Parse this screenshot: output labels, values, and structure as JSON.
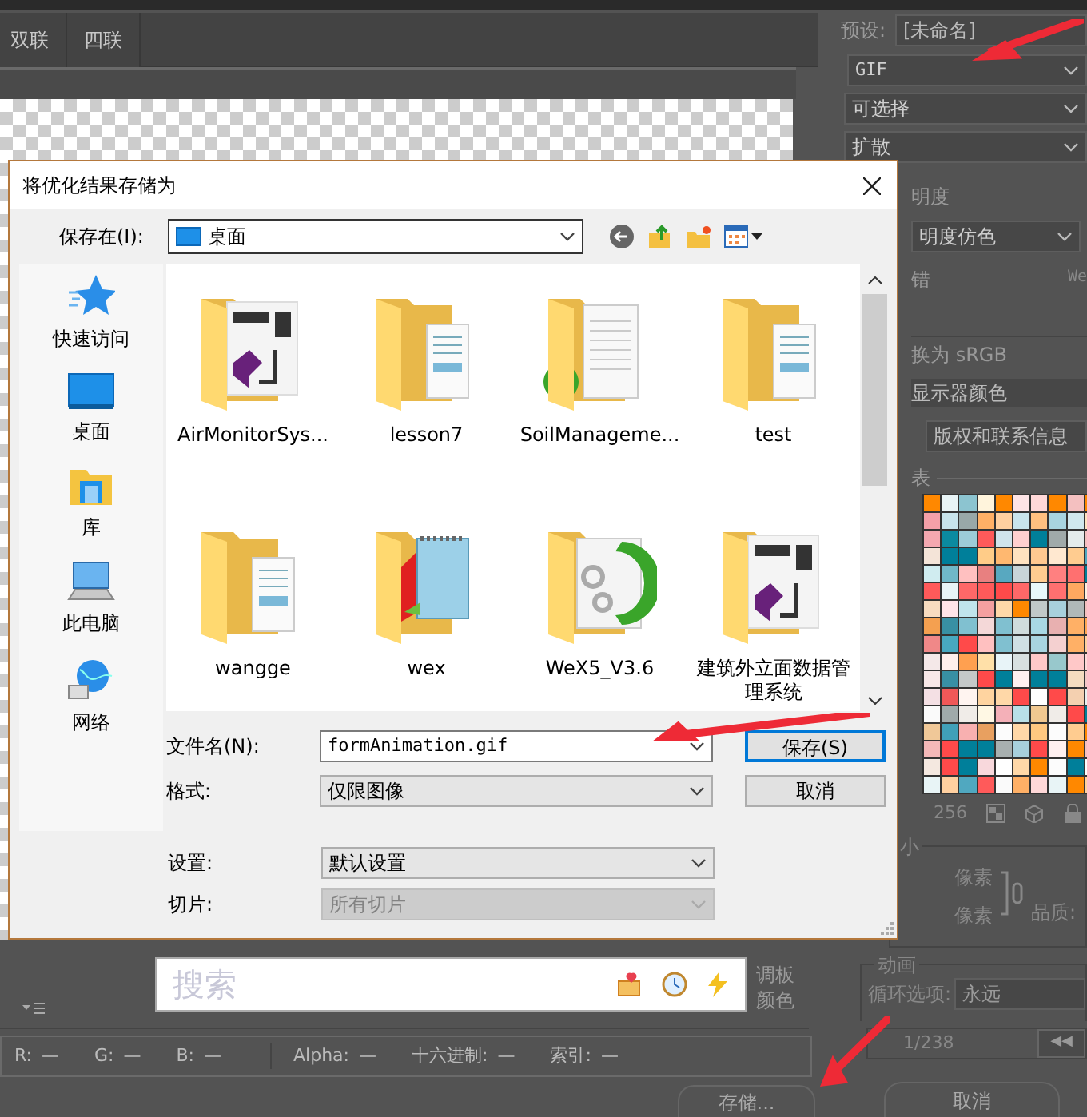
{
  "tabs": [
    {
      "label": "双联",
      "selected": false
    },
    {
      "label": "四联",
      "selected": false
    }
  ],
  "settings": {
    "preset_label": "预设:",
    "preset_value": "[未命名]",
    "format": "GIF",
    "palette_mode": "可选择",
    "dither_mode": "扩散",
    "transparency_label": "明度",
    "transparency_dither": "明度仿色",
    "matte_label": "错",
    "web_snap_label": "We",
    "convert_label": "换为 sRGB",
    "preview": "显示器颜色",
    "metadata": "版权和联系信息",
    "color_table_label": "表",
    "color_count": "256"
  },
  "swatches": [
    {
      "color": "#ff8800"
    },
    {
      "color": "#e8f4f6"
    },
    {
      "color": "#8cc4d0"
    },
    {
      "color": "#fff4dc"
    },
    {
      "color": "#ff8800"
    },
    {
      "color": "#fde4e6"
    },
    {
      "color": "#ffd8d8"
    },
    {
      "color": "#ff8800"
    },
    {
      "color": "#f4c0c0"
    },
    {
      "color": "#ff8800"
    },
    {
      "color": "#f4a0a8"
    },
    {
      "color": "#c8e4ec"
    },
    {
      "color": "#98a8a8"
    },
    {
      "color": "#ffb066"
    },
    {
      "color": "#ffd0a0"
    },
    {
      "color": "#c8e4ec"
    },
    {
      "color": "#ffc080"
    },
    {
      "color": "#a8d4e0"
    },
    {
      "color": "#d0e8ee"
    },
    {
      "color": "#ffe2c0"
    },
    {
      "color": "#f4a8b0"
    },
    {
      "color": "#0b8aa0"
    },
    {
      "color": "#9cccd8"
    },
    {
      "color": "#ff5a5a"
    },
    {
      "color": "#d0e4ec"
    },
    {
      "color": "#ffd0d0"
    },
    {
      "color": "#007f9a"
    },
    {
      "color": "#a0aaaa"
    },
    {
      "color": "#e4ecec"
    },
    {
      "color": "#f4c0c0"
    },
    {
      "color": "#f4e4d8"
    },
    {
      "color": "#007f9a"
    },
    {
      "color": "#007f9a"
    },
    {
      "color": "#ffcc88"
    },
    {
      "color": "#ffb870"
    },
    {
      "color": "#ffe2c0"
    },
    {
      "color": "#ffc890"
    },
    {
      "color": "#ffe8d0"
    },
    {
      "color": "#ffcc90"
    },
    {
      "color": "#50a8c0"
    },
    {
      "color": "#d0ecf0"
    },
    {
      "color": "#70b8c8"
    },
    {
      "color": "#ffc0c0"
    },
    {
      "color": "#e88080"
    },
    {
      "color": "#58a8c0"
    },
    {
      "color": "#c8d4d8"
    },
    {
      "color": "#ffcc90"
    },
    {
      "color": "#ff8080"
    },
    {
      "color": "#ff7070"
    },
    {
      "color": "#007f9a"
    },
    {
      "color": "#ff5a5a"
    },
    {
      "color": "#e8f4f6"
    },
    {
      "color": "#ff6868"
    },
    {
      "color": "#ff5a5a"
    },
    {
      "color": "#ff4a4a"
    },
    {
      "color": "#ff6868"
    },
    {
      "color": "#e8f8fa"
    },
    {
      "color": "#ff7070"
    },
    {
      "color": "#ffa860"
    },
    {
      "color": "#fff0e0"
    },
    {
      "color": "#f8dcc0"
    },
    {
      "color": "#ffe4e8"
    },
    {
      "color": "#c0e4ec"
    },
    {
      "color": "#f4a0a0"
    },
    {
      "color": "#ffd8a8"
    },
    {
      "color": "#ff8800"
    },
    {
      "color": "#c0c8c8"
    },
    {
      "color": "#a8d0dc"
    },
    {
      "color": "#b0b8b8"
    },
    {
      "color": "#f4c0c0"
    },
    {
      "color": "#f4a050"
    },
    {
      "color": "#3890a4"
    },
    {
      "color": "#80c0d0"
    },
    {
      "color": "#f4d8d8"
    },
    {
      "color": "#80c0d0"
    },
    {
      "color": "#d0dcdc"
    },
    {
      "color": "#a8d8e4"
    },
    {
      "color": "#e8b0b0"
    },
    {
      "color": "#ffb066"
    },
    {
      "color": "#ffa858"
    },
    {
      "color": "#f08888"
    },
    {
      "color": "#48a8c0"
    },
    {
      "color": "#ff4a4a"
    },
    {
      "color": "#ffc0c0"
    },
    {
      "color": "#80c0d0"
    },
    {
      "color": "#d0e0e4"
    },
    {
      "color": "#a8d4e0"
    },
    {
      "color": "#f4d0d0"
    },
    {
      "color": "#ffb066"
    },
    {
      "color": "#ffd0a0"
    },
    {
      "color": "#f4e8e8"
    },
    {
      "color": "#fff0ec"
    },
    {
      "color": "#ffa050"
    },
    {
      "color": "#ffe0a8"
    },
    {
      "color": "#e8f4f8"
    },
    {
      "color": "#d8e0e0"
    },
    {
      "color": "#ffc8c8"
    },
    {
      "color": "#98c8cc"
    },
    {
      "color": "#ffc8c8"
    },
    {
      "color": "#ffd8d8"
    },
    {
      "color": "#f8e8e8"
    },
    {
      "color": "#3890a4"
    },
    {
      "color": "#c4c8c8"
    },
    {
      "color": "#ff4a4a"
    },
    {
      "color": "#007f9a"
    },
    {
      "color": "#fff0f0"
    },
    {
      "color": "#007f9a"
    },
    {
      "color": "#007f9a"
    },
    {
      "color": "#f4dcc0"
    },
    {
      "color": "#f4c8c8"
    },
    {
      "color": "#f4e0e4"
    },
    {
      "color": "#f05858"
    },
    {
      "color": "#fff4f0"
    },
    {
      "color": "#ffd4a0"
    },
    {
      "color": "#ffd8a8"
    },
    {
      "color": "#ff4a4a"
    },
    {
      "color": "#ffffff"
    },
    {
      "color": "#ff4a4a"
    },
    {
      "color": "#f4d0b0"
    },
    {
      "color": "#e8f0f0"
    },
    {
      "color": "#fafafa"
    },
    {
      "color": "#a0aaaa"
    },
    {
      "color": "#f0ece8"
    },
    {
      "color": "#fff8e4"
    },
    {
      "color": "#f4b0b8"
    },
    {
      "color": "#b8e0e8"
    },
    {
      "color": "#f0c890"
    },
    {
      "color": "#f0ece8"
    },
    {
      "color": "#ff4a4a"
    },
    {
      "color": "#007f9a"
    },
    {
      "color": "#f0c898"
    },
    {
      "color": "#40a0b8"
    },
    {
      "color": "#f8b0b0"
    },
    {
      "color": "#e8a060"
    },
    {
      "color": "#fcfcfc"
    },
    {
      "color": "#ffd8a8"
    },
    {
      "color": "#ffc880"
    },
    {
      "color": "#fcfcfc"
    },
    {
      "color": "#ffcc90"
    },
    {
      "color": "#ff8800"
    },
    {
      "color": "#f4b8b8"
    },
    {
      "color": "#ff4a4a"
    },
    {
      "color": "#007f9a"
    },
    {
      "color": "#007f9a"
    },
    {
      "color": "#a8b0b0"
    },
    {
      "color": "#a8d0dc"
    },
    {
      "color": "#ff4a4a"
    },
    {
      "color": "#fff0f0"
    },
    {
      "color": "#ff8800"
    },
    {
      "color": "#f4c0c0"
    },
    {
      "color": "#f4e8e0"
    },
    {
      "color": "#ff4a4a"
    },
    {
      "color": "#007f9a"
    },
    {
      "color": "#f8d8dc"
    },
    {
      "color": "#ffffff"
    },
    {
      "color": "#ffd8a8"
    },
    {
      "color": "#ff8800"
    },
    {
      "color": "#fcfcfc"
    },
    {
      "color": "#007f9a"
    },
    {
      "color": "#fcfcfc"
    },
    {
      "color": "#e8f4f6"
    },
    {
      "color": "#ffd0a0"
    },
    {
      "color": "#50a8c0"
    },
    {
      "color": "#ff5a5a"
    },
    {
      "color": "#fafafa"
    },
    {
      "color": "#ffb066"
    },
    {
      "color": "#ffd8d8"
    },
    {
      "color": "#e8f4f6"
    },
    {
      "color": "#ff8800"
    },
    {
      "color": "#ffd0a0"
    }
  ],
  "image_size": {
    "label": "小",
    "width_unit": "像素",
    "height_unit": "像素",
    "quality_label": "品质:"
  },
  "animation": {
    "label": "动画",
    "loop_label": "循环选项:",
    "loop_value": "永远",
    "frame": "1/238",
    "first_frame_button": "◀◀"
  },
  "preview_info": [
    "调板",
    "颜色"
  ],
  "search": {
    "placeholder": "搜索"
  },
  "status_bar": [
    {
      "label": "R:",
      "value": "—"
    },
    {
      "label": "G:",
      "value": "—"
    },
    {
      "label": "B:",
      "value": "—"
    },
    {
      "label": "Alpha:",
      "value": "—"
    },
    {
      "label": "十六进制:",
      "value": "—"
    },
    {
      "label": "索引:",
      "value": "—"
    }
  ],
  "bottom_buttons": [
    "存储...",
    "取消"
  ],
  "dialog": {
    "title": "将优化结果存储为",
    "save_in_label": "保存在(I):",
    "save_in_value": "桌面",
    "places": [
      {
        "label": "快速访问",
        "kind": "quick"
      },
      {
        "label": "桌面",
        "kind": "desktop"
      },
      {
        "label": "库",
        "kind": "library"
      },
      {
        "label": "此电脑",
        "kind": "computer"
      },
      {
        "label": "网络",
        "kind": "network"
      }
    ],
    "files": [
      {
        "name": "AirMonitorSys...",
        "kind": "vsproject"
      },
      {
        "name": "lesson7",
        "kind": "documents"
      },
      {
        "name": "SoilManageme...",
        "kind": "synced"
      },
      {
        "name": "test",
        "kind": "documents"
      },
      {
        "name": "wangge",
        "kind": "documents"
      },
      {
        "name": "wex",
        "kind": "notepad"
      },
      {
        "name": "WeX5_V3.6",
        "kind": "webapp"
      },
      {
        "name": "建筑外立面数据管理系统",
        "kind": "vsproject"
      }
    ],
    "filename_label": "文件名(N):",
    "filename_value": "formAnimation.gif",
    "format_label": "格式:",
    "format_value": "仅限图像",
    "settings_label": "设置:",
    "settings_value": "默认设置",
    "slices_label": "切片:",
    "slices_value": "所有切片",
    "slices_disabled": true,
    "buttons": [
      {
        "label": "保存(S)",
        "default": true
      },
      {
        "label": "取消",
        "default": false
      }
    ]
  }
}
